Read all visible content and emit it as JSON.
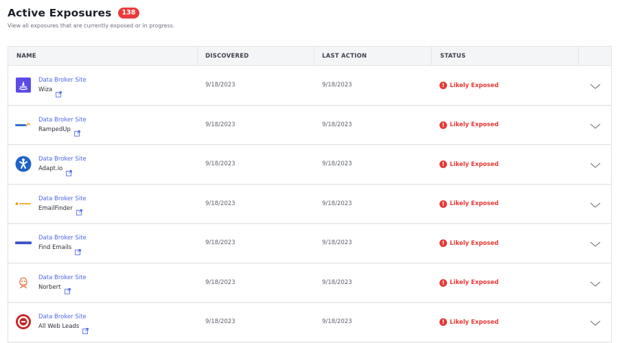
{
  "header": {
    "title": "Active Exposures",
    "count": "138",
    "subtitle": "View all exposures that are currently exposed or in progress."
  },
  "table": {
    "columns": [
      "NAME",
      "DISCOVERED",
      "LAST ACTION",
      "STATUS"
    ],
    "rows": [
      {
        "category": "Data Broker Site",
        "name": "Wiza",
        "discovered": "9/18/2023",
        "last_action": "9/18/2023",
        "status": "Likely Exposed",
        "logo": "wiza-logo"
      },
      {
        "category": "Data Broker Site",
        "name": "RampedUp",
        "discovered": "9/18/2023",
        "last_action": "9/18/2023",
        "status": "Likely Exposed",
        "logo": "rampedup-logo"
      },
      {
        "category": "Data Broker Site",
        "name": "Adapt.io",
        "discovered": "9/18/2023",
        "last_action": "9/18/2023",
        "status": "Likely Exposed",
        "logo": "adapt-logo"
      },
      {
        "category": "Data Broker Site",
        "name": "EmailFinder",
        "discovered": "9/18/2023",
        "last_action": "9/18/2023",
        "status": "Likely Exposed",
        "logo": "emailfinder-logo"
      },
      {
        "category": "Data Broker Site",
        "name": "Find Emails",
        "discovered": "9/18/2023",
        "last_action": "9/18/2023",
        "status": "Likely Exposed",
        "logo": "findemails-logo"
      },
      {
        "category": "Data Broker Site",
        "name": "Norbert",
        "discovered": "9/18/2023",
        "last_action": "9/18/2023",
        "status": "Likely Exposed",
        "logo": "norbert-logo"
      },
      {
        "category": "Data Broker Site",
        "name": "All Web Leads",
        "discovered": "9/18/2023",
        "last_action": "9/18/2023",
        "status": "Likely Exposed",
        "logo": "allwebleads-logo"
      }
    ]
  },
  "colors": {
    "link": "#4b66e6",
    "danger": "#e53935",
    "badge": "#ea3b3b"
  },
  "icons": {
    "external": "external-link-icon",
    "status": "alert-icon",
    "expand": "chevron-down-icon"
  }
}
